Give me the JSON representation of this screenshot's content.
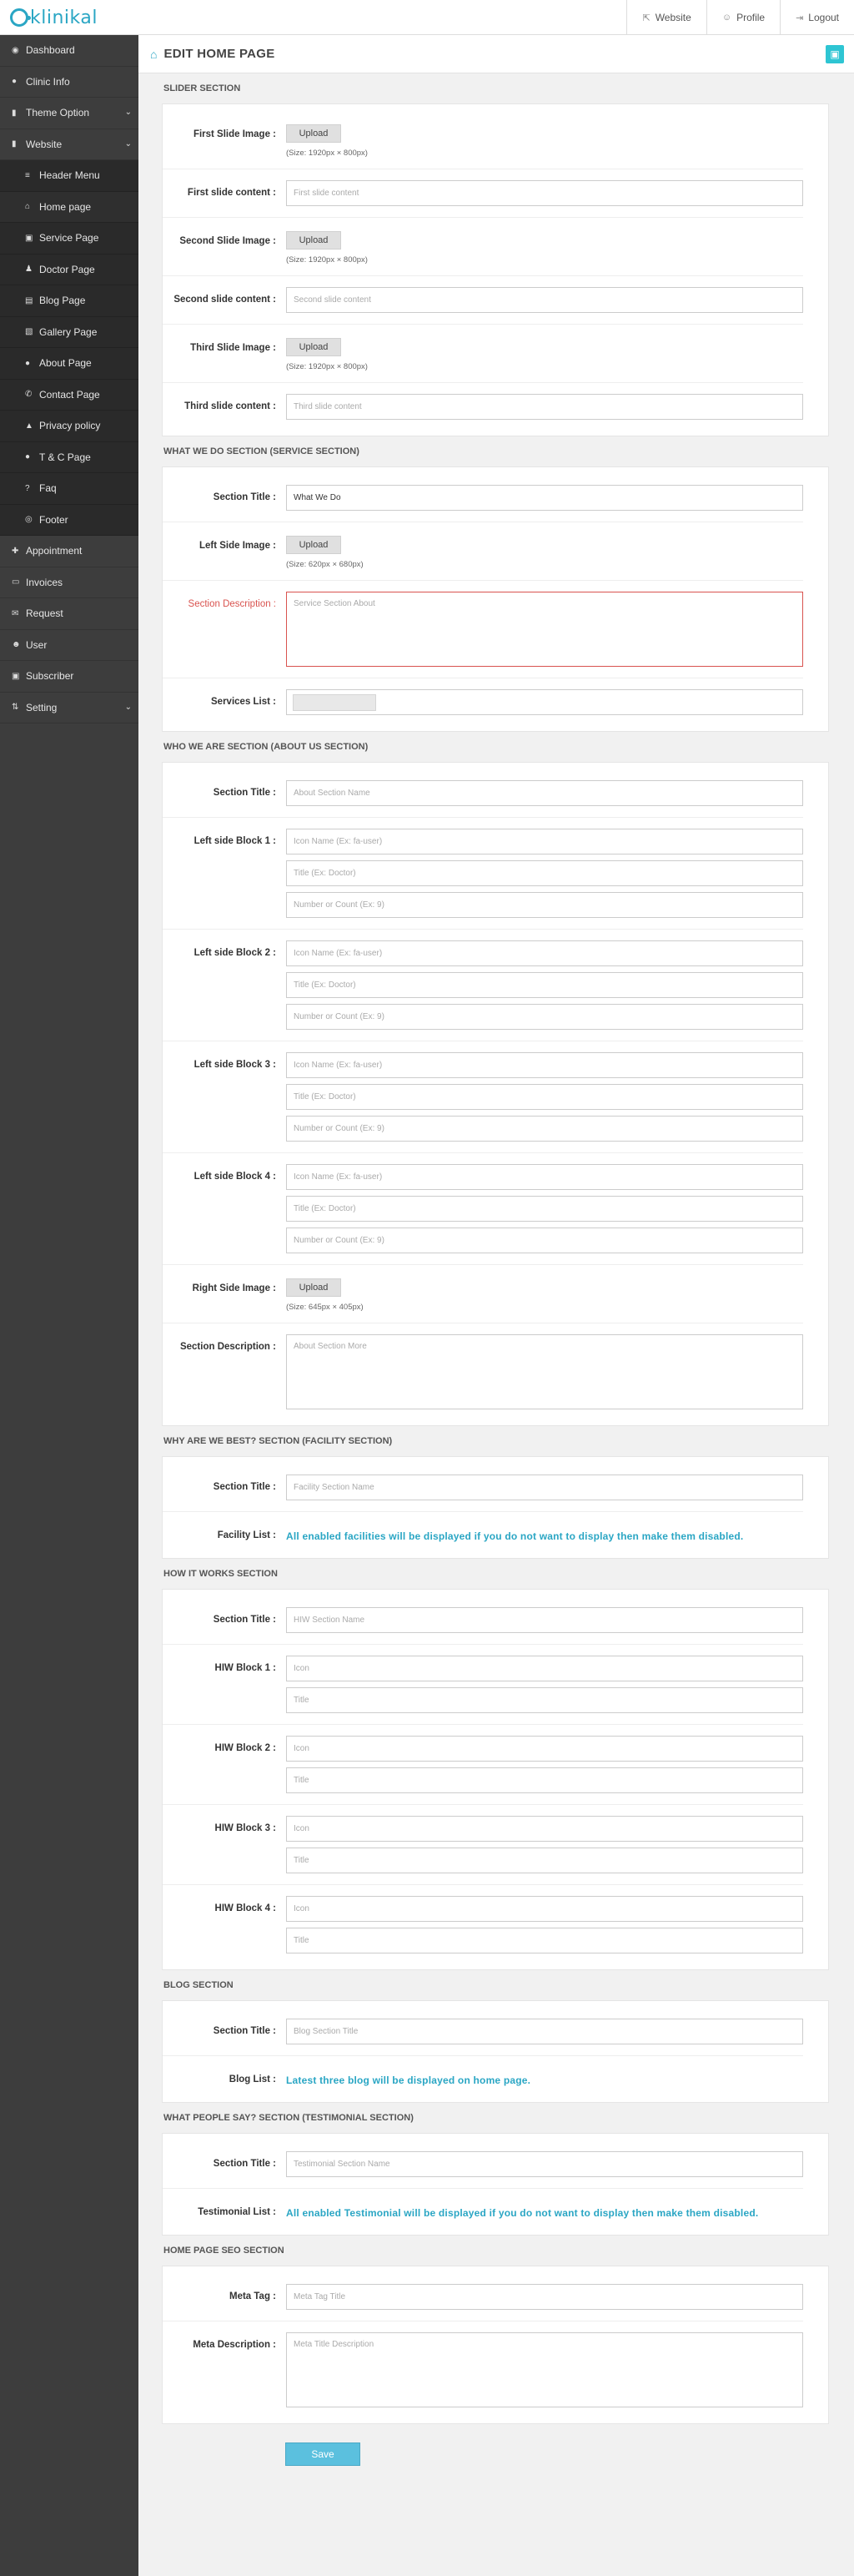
{
  "app": {
    "logo_text": "klinikal",
    "brand_color": "#2aa6c4"
  },
  "topnav": [
    {
      "label": "Website",
      "icon": "external-link-icon",
      "glyph": "⇱"
    },
    {
      "label": "Profile",
      "icon": "user-icon",
      "glyph": "☺"
    },
    {
      "label": "Logout",
      "icon": "logout-icon",
      "glyph": "⇥"
    }
  ],
  "sidebar": {
    "items": [
      {
        "label": "Dashboard",
        "glyph": "◉",
        "icon": "dashboard-icon",
        "name": "dashboard"
      },
      {
        "label": "Clinic Info",
        "glyph": "●",
        "icon": "info-icon",
        "name": "clinic-info"
      },
      {
        "label": "Theme Option",
        "glyph": "▮",
        "icon": "theme-icon",
        "name": "theme-option",
        "chevron": true
      },
      {
        "label": "Website",
        "glyph": "▮",
        "icon": "website-icon",
        "name": "website",
        "chevron": true
      },
      {
        "label": "Header Menu",
        "glyph": "≡",
        "icon": "menu-icon",
        "name": "header-menu",
        "sub": true
      },
      {
        "label": "Home page",
        "glyph": "⌂",
        "icon": "home-icon",
        "name": "home-page",
        "sub": true,
        "active": true
      },
      {
        "label": "Service Page",
        "glyph": "▣",
        "icon": "camera-icon",
        "name": "service-page",
        "sub": true
      },
      {
        "label": "Doctor Page",
        "glyph": "♟",
        "icon": "doctor-icon",
        "name": "doctor-page",
        "sub": true
      },
      {
        "label": "Blog Page",
        "glyph": "▤",
        "icon": "file-icon",
        "name": "blog-page",
        "sub": true
      },
      {
        "label": "Gallery Page",
        "glyph": "▧",
        "icon": "image-icon",
        "name": "gallery-page",
        "sub": true
      },
      {
        "label": "About Page",
        "glyph": "●",
        "icon": "info-icon",
        "name": "about-page",
        "sub": true
      },
      {
        "label": "Contact Page",
        "glyph": "✆",
        "icon": "phone-icon",
        "name": "contact-page",
        "sub": true
      },
      {
        "label": "Privacy policy",
        "glyph": "▲",
        "icon": "lock-icon",
        "name": "privacy-policy",
        "sub": true
      },
      {
        "label": "T & C Page",
        "glyph": "●",
        "icon": "terms-icon",
        "name": "tc-page",
        "sub": true
      },
      {
        "label": "Faq",
        "glyph": "?",
        "icon": "question-icon",
        "name": "faq",
        "sub": true
      },
      {
        "label": "Footer",
        "glyph": "◎",
        "icon": "footer-icon",
        "name": "footer",
        "sub": true
      },
      {
        "label": "Appointment",
        "glyph": "✚",
        "icon": "plus-icon",
        "name": "appointment"
      },
      {
        "label": "Invoices",
        "glyph": "▭",
        "icon": "credit-card-icon",
        "name": "invoices"
      },
      {
        "label": "Request",
        "glyph": "✉",
        "icon": "envelope-icon",
        "name": "request"
      },
      {
        "label": "User",
        "glyph": "☻",
        "icon": "users-icon",
        "name": "user"
      },
      {
        "label": "Subscriber",
        "glyph": "▣",
        "icon": "subscriber-icon",
        "name": "subscriber"
      },
      {
        "label": "Setting",
        "glyph": "⇅",
        "icon": "settings-icon",
        "name": "setting",
        "chevron": true
      }
    ]
  },
  "header": {
    "title": "EDIT HOME PAGE",
    "home_glyph": "⌂",
    "save_glyph": "▣"
  },
  "slider": {
    "heading": "SLIDER SECTION",
    "upload_label": "Upload",
    "size_note": "(Size: 1920px × 800px)",
    "first_image": "First Slide Image :",
    "first_content": "First slide content :",
    "first_ph": "First slide content",
    "second_image": "Second Slide Image :",
    "second_content": "Second slide content :",
    "second_ph": "Second slide content",
    "third_image": "Third Slide Image :",
    "third_content": "Third slide content :",
    "third_ph": "Third slide content"
  },
  "service": {
    "heading": "WHAT WE DO SECTION (SERVICE SECTION)",
    "title_label": "Section Title :",
    "title_value": "What We Do",
    "left_image": "Left Side Image :",
    "upload_label": "Upload",
    "size_note": "(Size: 620px × 680px)",
    "desc_label": "Section Description :",
    "desc_ph": "Service Section About",
    "list_label": "Services List :"
  },
  "about": {
    "heading": "WHO WE ARE SECTION (ABOUT US SECTION)",
    "title_label": "Section Title :",
    "title_ph": "About Section Name",
    "block1": "Left side Block 1 :",
    "block2": "Left side Block 2 :",
    "block3": "Left side Block 3 :",
    "block4": "Left side Block 4 :",
    "icon_ph": "Icon Name (Ex: fa-user)",
    "title_sub_ph": "Title (Ex: Doctor)",
    "count_ph": "Number or Count (Ex: 9)",
    "right_image": "Right Side Image :",
    "upload_label": "Upload",
    "size_note": "(Size: 645px × 405px)",
    "desc_label": "Section Description :",
    "desc_ph": "About Section More"
  },
  "facility": {
    "heading": "WHY ARE WE BEST? SECTION (FACILITY SECTION)",
    "title_label": "Section Title :",
    "title_ph": "Facility Section Name",
    "list_label": "Facility List :",
    "list_info": "All enabled facilities will be displayed if you do not want to display then make them disabled."
  },
  "hiw": {
    "heading": "HOW IT WORKS SECTION",
    "title_label": "Section Title :",
    "title_ph": "HIW Section Name",
    "block1": "HIW Block 1 :",
    "block2": "HIW Block 2 :",
    "block3": "HIW Block 3 :",
    "block4": "HIW Block 4 :",
    "icon_ph": "Icon",
    "title_sub_ph": "Title"
  },
  "blog": {
    "heading": "BLOG SECTION",
    "title_label": "Section Title :",
    "title_ph": "Blog Section Title",
    "list_label": "Blog List :",
    "list_info": "Latest three blog will be displayed on home page."
  },
  "testimonial": {
    "heading": "WHAT PEOPLE SAY? SECTION (TESTIMONIAL SECTION)",
    "title_label": "Section Title :",
    "title_ph": "Testimonial Section Name",
    "list_label": "Testimonial List :",
    "list_info": "All enabled Testimonial will be displayed if you do not want to display then make them disabled."
  },
  "seo": {
    "heading": "HOME PAGE SEO SECTION",
    "meta_tag_label": "Meta Tag :",
    "meta_tag_ph": "Meta Tag Title",
    "meta_desc_label": "Meta Description :",
    "meta_desc_ph": "Meta Title Description"
  },
  "footer_actions": {
    "save_label": "Save"
  }
}
